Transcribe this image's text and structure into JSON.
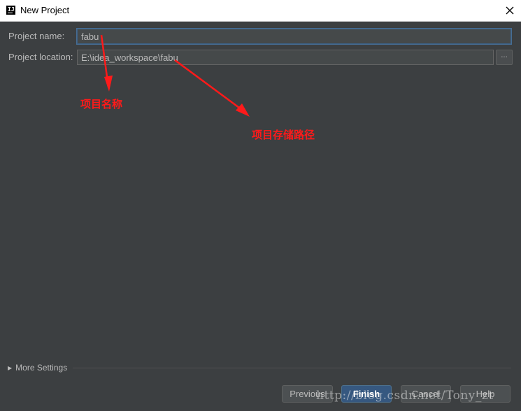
{
  "window": {
    "title": "New Project"
  },
  "form": {
    "project_name_label": "Project name:",
    "project_name_value": "fabu",
    "project_location_label": "Project location:",
    "project_location_value": "E:\\idea_workspace\\fabu",
    "browse_label": "..."
  },
  "annotations": {
    "name_note": "项目名称",
    "location_note": "项目存储路径",
    "color": "#ff1a1a"
  },
  "more_settings": {
    "label": "More Settings"
  },
  "buttons": {
    "previous": "Previous",
    "finish": "Finish",
    "cancel": "Cancel",
    "help": "Help"
  },
  "watermark": "http://blog.csdn.net/Tony_zt",
  "colors": {
    "background": "#3c3f41",
    "primary_button": "#365880",
    "annotation": "#ff1a1a"
  }
}
